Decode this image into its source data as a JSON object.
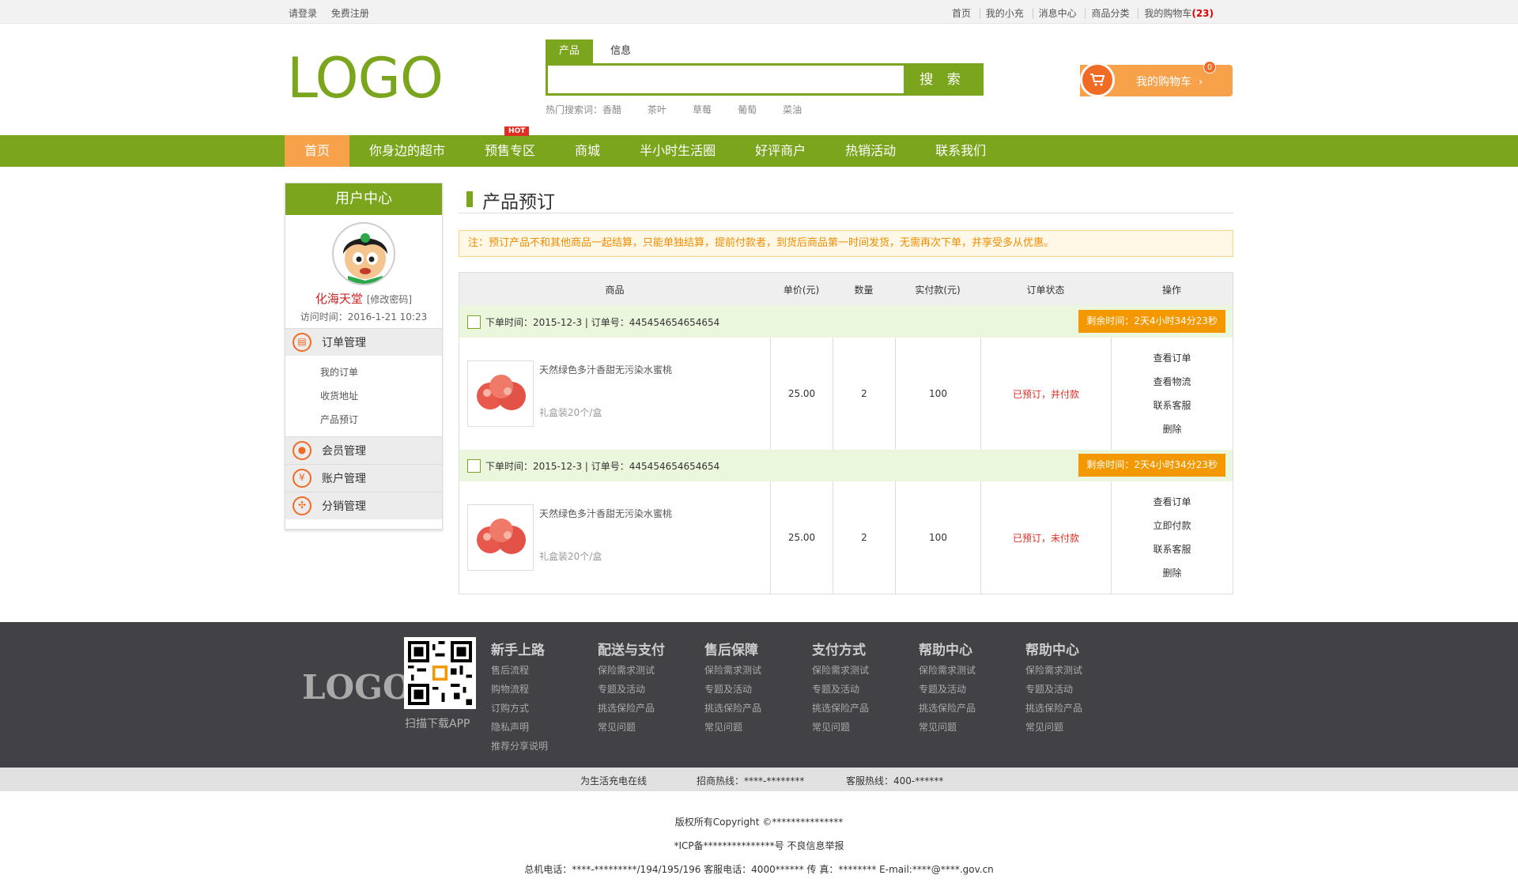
{
  "topbar": {
    "login": "请登录",
    "register": "免费注册",
    "links": [
      "首页",
      "我的小充",
      "消息中心",
      "商品分类"
    ],
    "cart_prefix": "我的购物车",
    "cart_count": "(23)"
  },
  "header": {
    "logo": "LOGO",
    "search_tabs": [
      "产品",
      "信息"
    ],
    "search_button": "搜 索",
    "hot_label": "热门搜索词：",
    "hot_words": [
      "香醋",
      "茶叶",
      "草莓",
      "葡萄",
      "菜油"
    ],
    "cart_label": "我的购物车",
    "cart_arrow": "›",
    "cart_badge": "0"
  },
  "nav": {
    "items": [
      "首页",
      "你身边的超市",
      "预售专区",
      "商城",
      "半小时生活圈",
      "好评商户",
      "热销活动",
      "联系我们"
    ],
    "hot_badge": "HOT"
  },
  "sidebar": {
    "title": "用户中心",
    "username": "化海天堂",
    "change_pwd": "[修改密码]",
    "visit_time": "访问时间：2016-1-21 10:23",
    "menu": [
      {
        "label": "订单管理",
        "icon": "document-icon",
        "glyph": "▤"
      },
      {
        "label": "会员管理",
        "icon": "user-icon",
        "glyph": "●"
      },
      {
        "label": "账户管理",
        "icon": "yen-icon",
        "glyph": "¥"
      },
      {
        "label": "分销管理",
        "icon": "share-icon",
        "glyph": "✣"
      }
    ],
    "order_sub": [
      "我的订单",
      "收货地址",
      "产品预订"
    ]
  },
  "main": {
    "title": "产品预订",
    "notice": "注：预订产品不和其他商品一起结算，只能单独结算，提前付款者，到货后商品第一时间发货，无需再次下单，并享受多从优惠。",
    "columns": [
      "商品",
      "单价(元)",
      "数量",
      "实付款(元)",
      "订单状态",
      "操作"
    ],
    "orders": [
      {
        "info": "下单时间：2015-12-3 | 订单号：445454654654654",
        "remain": "剩余时间：2天4小时34分23秒",
        "product": "天然绿色多汁香甜无污染水蜜桃",
        "spec": "礼盒装20个/盒",
        "price": "25.00",
        "qty": "2",
        "paid": "100",
        "status": "已预订，并付款",
        "ops": [
          "查看订单",
          "查看物流",
          "联系客服",
          "删除"
        ]
      },
      {
        "info": "下单时间：2015-12-3 | 订单号：445454654654654",
        "remain": "剩余时间：2天4小时34分23秒",
        "product": "天然绿色多汁香甜无污染水蜜桃",
        "spec": "礼盒装20个/盒",
        "price": "25.00",
        "qty": "2",
        "paid": "100",
        "status": "已预订，未付款",
        "ops": [
          "查看订单",
          "立即付款",
          "联系客服",
          "删除"
        ]
      }
    ]
  },
  "footer": {
    "logo": "LOGO",
    "qr_text": "扫描下载APP",
    "columns": [
      {
        "title": "新手上路",
        "links": [
          "售后流程",
          "购物流程",
          "订购方式",
          "隐私声明",
          "推荐分享说明"
        ]
      },
      {
        "title": "配送与支付",
        "links": [
          "保险需求测试",
          "专题及活动",
          "挑选保险产品",
          "常见问题"
        ]
      },
      {
        "title": "售后保障",
        "links": [
          "保险需求测试",
          "专题及活动",
          "挑选保险产品",
          "常见问题"
        ]
      },
      {
        "title": "支付方式",
        "links": [
          "保险需求测试",
          "专题及活动",
          "挑选保险产品",
          "常见问题"
        ]
      },
      {
        "title": "帮助中心",
        "links": [
          "保险需求测试",
          "专题及活动",
          "挑选保险产品",
          "常见问题"
        ]
      },
      {
        "title": "帮助中心",
        "links": [
          "保险需求测试",
          "专题及活动",
          "挑选保险产品",
          "常见问题"
        ]
      }
    ],
    "hotline": [
      "为生活充电在线",
      "招商热线：****-********",
      "客服热线：400-******"
    ],
    "copyright": [
      "版权所有Copyright ©***************",
      "*ICP备***************号 不良信息举报",
      "总机电话：****-*********/194/195/196 客服电话：4000****** 传 真：******** E-mail:****@****.gov.cn"
    ]
  },
  "colors": {
    "brand_green": "#7aa51d",
    "accent_orange": "#f7a14b",
    "alert_red": "#e02e24"
  }
}
